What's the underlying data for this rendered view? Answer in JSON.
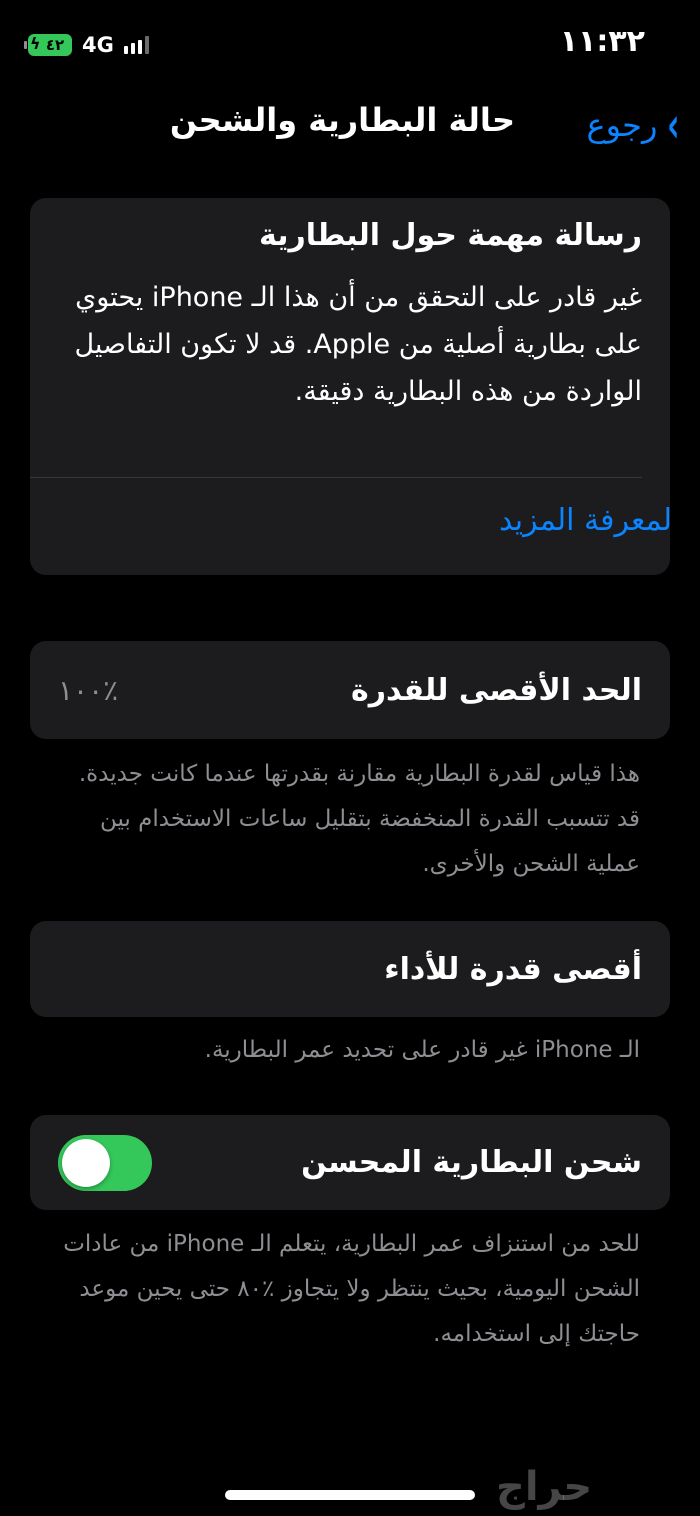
{
  "status_bar": {
    "time": "١١:٣٢",
    "battery_level": "٤٢",
    "network_type": "4G",
    "signal_bars_total": 4,
    "signal_bars_active": 3,
    "battery_color": "#34c759"
  },
  "nav": {
    "back_label": "رجوع",
    "back_icon": "chevron-right-icon",
    "title": "حالة البطارية والشحن",
    "accent_color": "#0a84ff"
  },
  "message": {
    "title": "رسالة مهمة حول البطارية",
    "body": "غير قادر على التحقق من أن هذا الـ iPhone يحتوي على بطارية أصلية من Apple. قد لا تكون التفاصيل الواردة من هذه البطارية دقيقة.",
    "link_label": "لمعرفة المزيد"
  },
  "capacity": {
    "label": "الحد الأقصى للقدرة",
    "value": "٪١٠٠",
    "footnote": "هذا قياس لقدرة البطارية مقارنة بقدرتها عندما كانت جديدة. قد تتسبب القدرة المنخفضة بتقليل ساعات الاستخدام بين عملية الشحن والأخرى."
  },
  "performance": {
    "label": "أقصى قدرة للأداء",
    "footnote": "الـ iPhone غير قادر على تحديد عمر البطارية."
  },
  "optimized_charging": {
    "label": "شحن البطارية المحسن",
    "toggle_on": true,
    "toggle_color": "#34c759",
    "footnote": "للحد من استنزاف عمر البطارية، يتعلم الـ iPhone من عادات الشحن اليومية، بحيث ينتظر ولا يتجاوز ٪٨٠ حتى يحين موعد حاجتك إلى استخدامه."
  },
  "watermark": "حراج"
}
